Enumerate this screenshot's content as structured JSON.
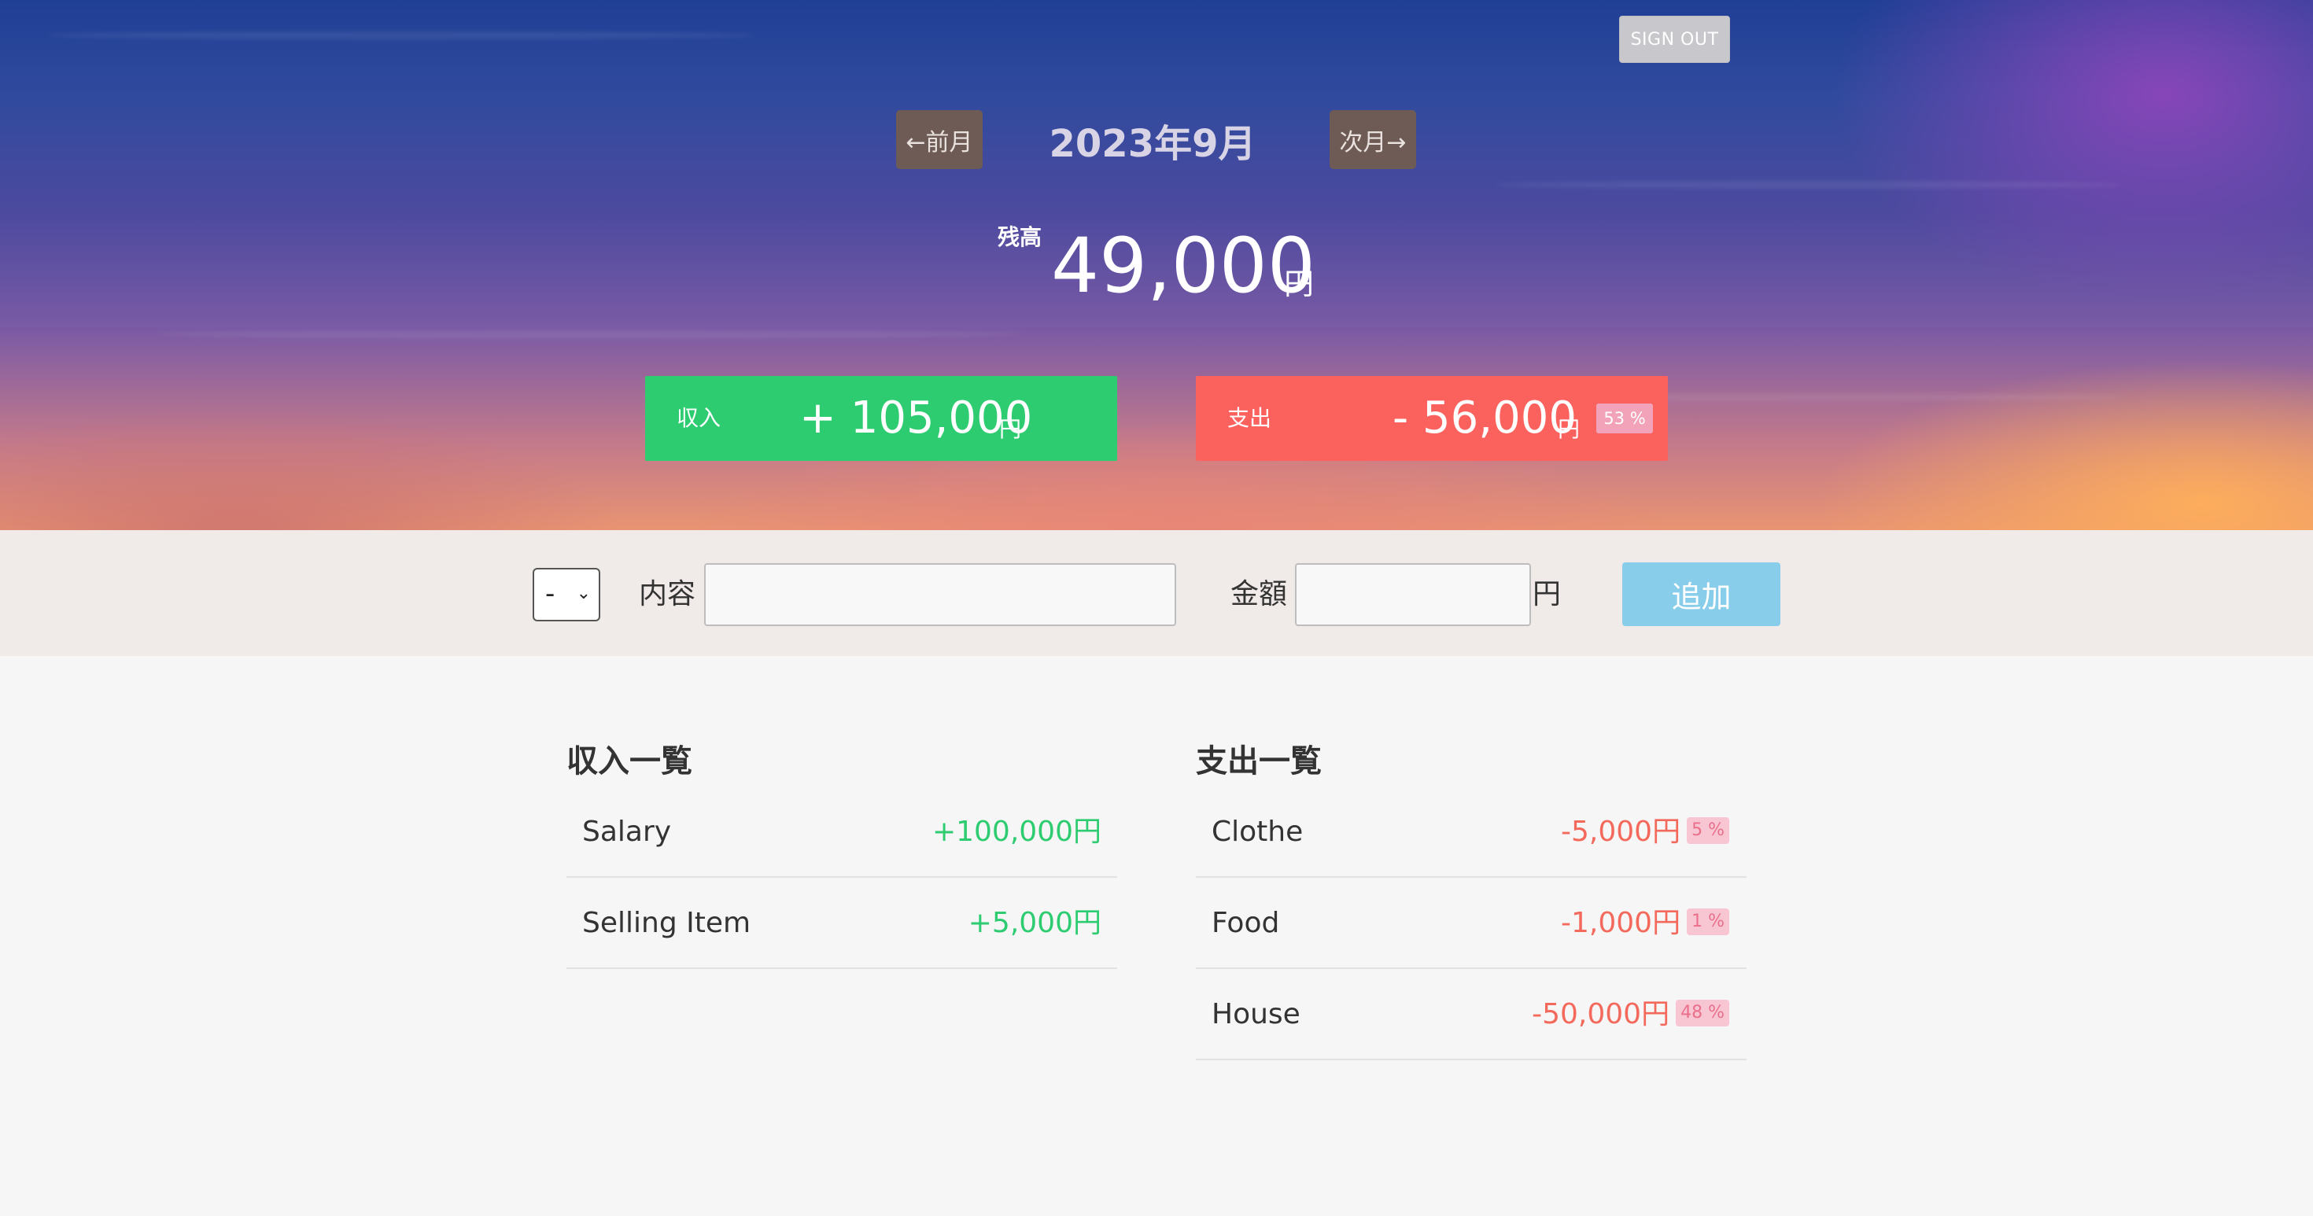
{
  "header": {
    "sign_out_label": "SIGN OUT",
    "prev_month_label": "←前月",
    "next_month_label": "次月→",
    "current_month": "2023年9月"
  },
  "balance": {
    "label": "残高",
    "value": "49,000",
    "unit": "円"
  },
  "summary": {
    "income": {
      "label": "収入",
      "amount": "+ 105,000",
      "unit": "円",
      "color": "#2ecc71"
    },
    "expense": {
      "label": "支出",
      "amount": "- 56,000",
      "unit": "円",
      "percent": "53 %",
      "color": "#fb625e"
    }
  },
  "form": {
    "type_select_value": "-",
    "content_label": "内容",
    "content_value": "",
    "amount_label": "金額",
    "amount_value": "",
    "amount_unit": "円",
    "add_button_label": "追加"
  },
  "income_list": {
    "title": "収入一覧",
    "items": [
      {
        "name": "Salary",
        "value": "+100,000円"
      },
      {
        "name": "Selling Item",
        "value": "+5,000円"
      }
    ]
  },
  "expense_list": {
    "title": "支出一覧",
    "items": [
      {
        "name": "Clothe",
        "value": "-5,000円",
        "percent": "5 %"
      },
      {
        "name": "Food",
        "value": "-1,000円",
        "percent": "1 %"
      },
      {
        "name": "House",
        "value": "-50,000円",
        "percent": "48 %"
      }
    ]
  },
  "colors": {
    "income": "#2ecc71",
    "expense": "#f36a5d",
    "add_button": "#88cde9",
    "nav_button": "#6e5b55"
  }
}
